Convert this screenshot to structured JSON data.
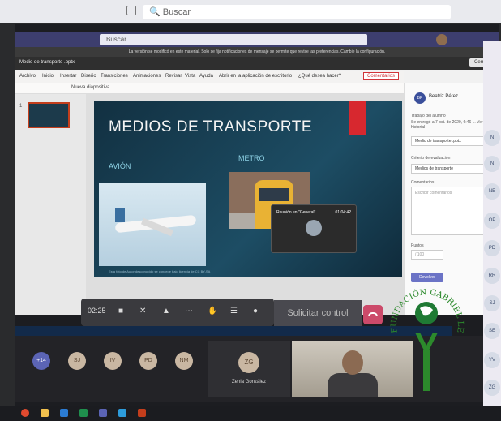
{
  "outer": {
    "search_placeholder": "Buscar"
  },
  "teams": {
    "search_placeholder": "Buscar"
  },
  "app": {
    "notice": "La versión se modificó en este material. Solo se fija notificaciones de mensaje se permite que revise las preferencias. Cambie la configuración.",
    "file_name": "Medio de transporte .pptx",
    "close_label": "Cerrar",
    "tabs": [
      "Archivo",
      "Inicio",
      "Insertar",
      "Diseño",
      "Transiciones",
      "Animaciones",
      "Revisar",
      "Vista",
      "Ayuda",
      "Abrir en la aplicación de escritorio",
      "¿Qué desea hacer?"
    ],
    "comments_label": "Comentarios",
    "toolbar_text": "Nueva diapositiva"
  },
  "slide": {
    "number": "1",
    "title": "MEDIOS DE TRANSPORTE",
    "label_plane": "AVIÓN",
    "label_train": "METRO",
    "caption": "Esta foto de Autor desconocido se concede bajo licencia de CC BY-SA"
  },
  "mini_meeting": {
    "title": "Reunión en \"General\"",
    "time": "01:04:42"
  },
  "comment_panel": {
    "avatar": "BP",
    "name": "Beatriz Pérez",
    "line1": "Trabajo del alumno",
    "line2": "Se entregó a 7 oct. de 2020, 6:46 ... Ver historial",
    "file": "Medio de transporte .pptx",
    "criteria_label": "Criterio de evaluación",
    "criteria_value": "Medios de transporte",
    "comments_label": "Comentarios",
    "comments_placeholder": "Escribir comentarios",
    "points_label": "Puntos",
    "points_value": "/ 100",
    "return_button": "Devolver"
  },
  "call": {
    "timer": "02:25",
    "share_control": "Solicitar control",
    "participants": [
      "+14",
      "SJ",
      "IV",
      "PD",
      "NM"
    ],
    "tile_initials": "ZG",
    "tile_name": "Zenia González"
  },
  "right_column": [
    "N",
    "N",
    "NE",
    "OP",
    "PD",
    "RR",
    "SJ",
    "SE",
    "YV",
    "ZG"
  ],
  "logo": {
    "text": "FUNDACIÓN GABRIEL LEWIS GALINDO"
  },
  "colors": {
    "teams": "#3d3e6e",
    "accent_red": "#d7282f",
    "hangup": "#cc4a6a",
    "brand_green": "#2c8a2c"
  }
}
